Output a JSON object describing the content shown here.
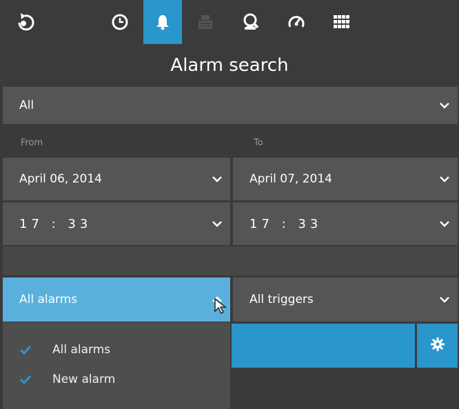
{
  "toolbar": {
    "icons": [
      "back-icon",
      "clock-icon",
      "bell-icon",
      "storage-icon",
      "search-icon",
      "gauge-icon",
      "grid-icon"
    ],
    "active": "bell-icon",
    "active_color": "#2996cc"
  },
  "title": "Alarm search",
  "filter": {
    "value": "All"
  },
  "from": {
    "label": "From",
    "date": "April 06, 2014",
    "time": "17 : 33"
  },
  "to": {
    "label": "To",
    "date": "April 07, 2014",
    "time": "17 : 33"
  },
  "alarm_type": {
    "value": "All alarms",
    "color": "#5ab0dc"
  },
  "trigger": {
    "value": "All triggers"
  },
  "search_button": {
    "color": "#2996cc"
  },
  "alarm_menu": {
    "items": [
      {
        "label": "All alarms",
        "checked": true
      },
      {
        "label": "New alarm",
        "checked": true
      }
    ]
  }
}
